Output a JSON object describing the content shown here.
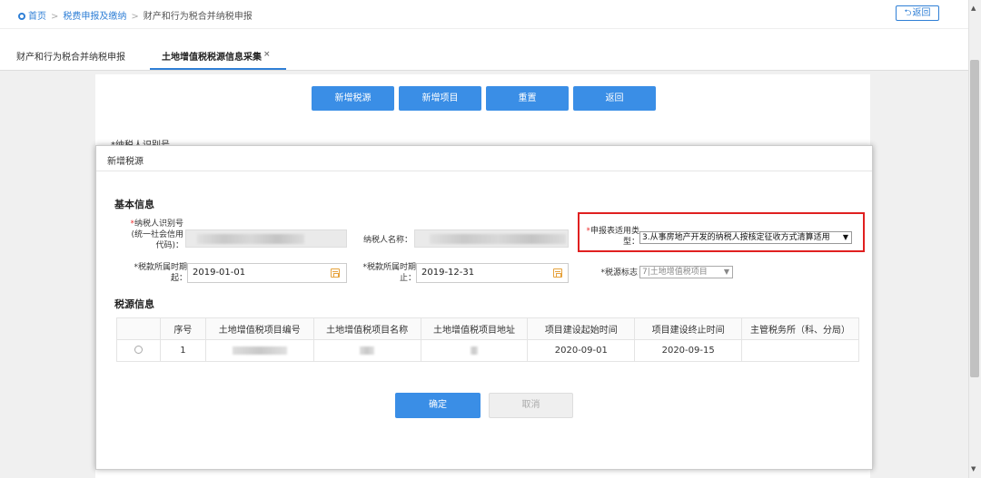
{
  "breadcrumb": {
    "home": "首页",
    "level1": "税费申报及缴纳",
    "level2": "财产和行为税合并纳税申报"
  },
  "back_button": "返回",
  "tabs": [
    {
      "label": "财产和行为税合并纳税申报",
      "active": false
    },
    {
      "label": "土地增值税税源信息采集",
      "active": true,
      "close": "×"
    }
  ],
  "toolbar": {
    "add_source": "新增税源",
    "add_project": "新增项目",
    "reset": "重置",
    "back": "返回"
  },
  "background_label": "*纳税人识别号",
  "modal": {
    "title": "新增税源",
    "basic_info": "基本信息",
    "taxpayer_id_label_req": "*",
    "taxpayer_id_label_1": "纳税人识别号",
    "taxpayer_id_label_2": "(统一社会信用",
    "taxpayer_id_label_3": "代码)：",
    "taxpayer_name_label": "纳税人名称：",
    "report_type_label_req": "*",
    "report_type_label_1": "申报表适用类",
    "report_type_label_2": "型：",
    "report_type_value": "3.从事房地产开发的纳税人按核定征收方式清算适用",
    "period_start_label_1": "*税款所属时期",
    "period_start_label_2": "起：",
    "period_start_value": "2019-01-01",
    "period_end_label_1": "*税款所属时期",
    "period_end_label_2": "止：",
    "period_end_value": "2019-12-31",
    "source_flag_label": "*税源标志",
    "source_flag_value": "7|土地增值税项目",
    "source_info": "税源信息",
    "table": {
      "headers": [
        "",
        "序号",
        "土地增值税项目编号",
        "土地增值税项目名称",
        "土地增值税项目地址",
        "项目建设起始时间",
        "项目建设终止时间",
        "主管税务所（科、分局）"
      ],
      "rows": [
        {
          "index": "1",
          "start": "2020-09-01",
          "end": "2020-09-15"
        }
      ]
    },
    "confirm": "确定",
    "cancel": "取消"
  },
  "colors": {
    "primary": "#3a8ee6",
    "highlight": "#e02020",
    "required": "#e33333"
  }
}
